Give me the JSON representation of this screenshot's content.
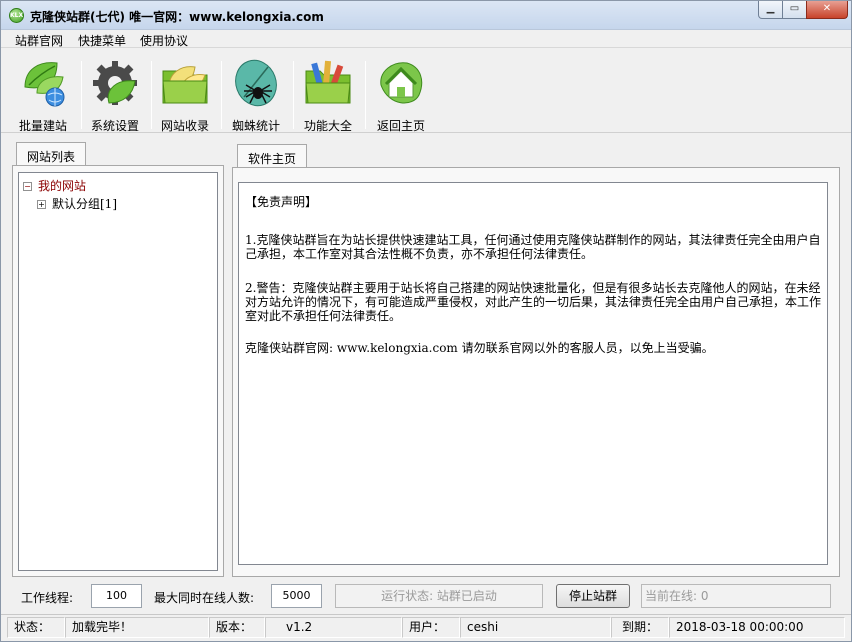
{
  "window": {
    "title": "克隆侠站群(七代)  唯一官网：www.kelongxia.com",
    "icon_text": "KLX"
  },
  "menu": [
    "站群官网",
    "快捷菜单",
    "使用协议"
  ],
  "toolbar": [
    {
      "label": "批量建站",
      "icon": "leaf-globe-icon"
    },
    {
      "label": "系统设置",
      "icon": "gear-leaf-icon"
    },
    {
      "label": "网站收录",
      "icon": "folder-leaf-icon"
    },
    {
      "label": "蜘蛛统计",
      "icon": "spider-leaf-icon"
    },
    {
      "label": "功能大全",
      "icon": "folder-tools-icon"
    },
    {
      "label": "返回主页",
      "icon": "home-icon"
    }
  ],
  "left_panel": {
    "tab": "网站列表",
    "tree": {
      "root": {
        "label": "我的网站",
        "expander": "⊟"
      },
      "child": {
        "label": "默认分组[1]",
        "expander": "+"
      }
    }
  },
  "main_panel": {
    "tab": "软件主页",
    "paragraphs": [
      "【免责声明】",
      "1.克隆侠站群旨在为站长提供快速建站工具，任何通过使用克隆侠站群制作的网站，其法律责任完全由用户自己承担，本工作室对其合法性概不负责，亦不承担任何法律责任。",
      "2.警告：克隆侠站群主要用于站长将自己搭建的网站快速批量化，但是有很多站长去克隆他人的网站，在未经对方站允许的情况下，有可能造成严重侵权，对此产生的一切后果，其法律责任完全由用户自己承担，本工作室对此不承担任何法律责任。",
      "克隆侠站群官网: www.kelongxia.com 请勿联系官网以外的客服人员，以免上当受骗。"
    ]
  },
  "controls": {
    "threads_label": "工作线程:",
    "threads_value": "100",
    "max_online_label": "最大同时在线人数:",
    "max_online_value": "5000",
    "run_status": "运行状态: 站群已启动",
    "stop_button": "停止站群",
    "current_online": "当前在线: 0"
  },
  "statusbar": {
    "status_label": "状态：",
    "status_value": "加载完毕！",
    "version_label": "版本：",
    "version_value": "v1.2",
    "user_label": "用户：",
    "user_value": "ceshi",
    "expire_label": "到期：",
    "expire_value": "2018-03-18 00:00:00"
  },
  "colors": {
    "tree_root": "#8b0000",
    "accent_green": "#3a9a1c"
  }
}
